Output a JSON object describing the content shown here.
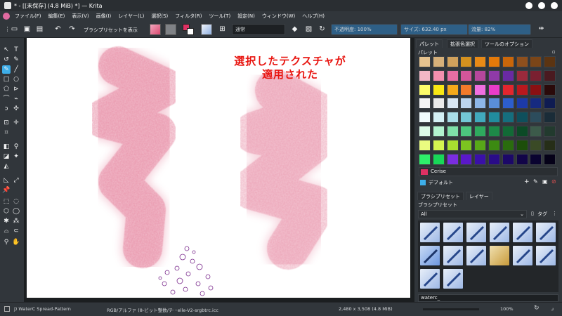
{
  "window": {
    "title": "* - [[未保存] (4.8 MiB) *] — Krita"
  },
  "menu": [
    "ファイル(F)",
    "編集(E)",
    "表示(V)",
    "画像(I)",
    "レイヤー(L)",
    "選択(S)",
    "フィルタ(R)",
    "ツール(T)",
    "設定(N)",
    "ウィンドウ(W)",
    "ヘルプ(H)"
  ],
  "toolbar": {
    "brush_preset_label": "ブラシプリセットを表示",
    "blend_mode": "通常",
    "opacity": "不透明度: 100%",
    "size": "サイズ: 632.40 px",
    "flow": "流量: 82%"
  },
  "canvas": {
    "annotation_line1": "選択したテクスチャが",
    "annotation_line2": "適用された",
    "annotation_color": "#e8140f",
    "stroke_color": "#e37895"
  },
  "palette_docker": {
    "tabs": [
      "パレット",
      "拡張色選択",
      "ツールのオプション"
    ],
    "title": "パレット",
    "selected_color_name": "Cerise",
    "selected_color": "#de3163",
    "palette_set": "デフォルト",
    "colors": [
      "#e6c38f",
      "#d6b07a",
      "#d0a15c",
      "#d4911f",
      "#e88a16",
      "#e3790a",
      "#c9660a",
      "#8e4f1d",
      "#7a4518",
      "#5b3412",
      "#f2b7c6",
      "#f290ae",
      "#e86ea3",
      "#d4569a",
      "#b5479c",
      "#8f3aa8",
      "#6a2aa2",
      "#9c2a3c",
      "#7a2030",
      "#4a1a20",
      "#fdfc6a",
      "#f9e814",
      "#f5a91a",
      "#f37a2a",
      "#f06fe0",
      "#e93cca",
      "#e2262e",
      "#b8181e",
      "#8a1012",
      "#2a0a0a",
      "#f5f5f5",
      "#eaeaea",
      "#d8e6f3",
      "#bcd4ee",
      "#8db6e8",
      "#5a8ed8",
      "#2d5ecc",
      "#1c3aa8",
      "#162a80",
      "#0f1c52",
      "#f0fbfc",
      "#d4f0f5",
      "#a9dde8",
      "#73c7d6",
      "#41a9bd",
      "#218c9e",
      "#156e7e",
      "#0e4f5c",
      "#2c4c5c",
      "#1a2c38",
      "#dcfbe8",
      "#b2f3cf",
      "#7fe0a8",
      "#4cc77e",
      "#2eaa5e",
      "#1d8a48",
      "#126a36",
      "#0c4a26",
      "#3c5a4a",
      "#223a2e",
      "#eafc80",
      "#d4f550",
      "#a8e030",
      "#7cc420",
      "#58a818",
      "#3c8a12",
      "#2a6c0e",
      "#1c4e0a",
      "#3a4a26",
      "#262e18",
      "#2ef06a",
      "#18d858",
      "#7a2de0",
      "#5a18c8",
      "#3a10a8",
      "#2a0c88",
      "#1c0868",
      "#120548",
      "#0a0330",
      "#050118"
    ]
  },
  "layers_docker": {
    "tabs": [
      "ブラシプリセット",
      "レイヤー"
    ]
  },
  "preset_docker": {
    "title": "ブラシプリセット",
    "filter_value": "All",
    "tag_label": "タグ",
    "search_value": "waterc_"
  },
  "status": {
    "brush_name": "j) WaterC Spread-Pattern",
    "color_profile": "RGB/アルファ (8-ビット整数/チ···elle-V2-srgbtrc.icc",
    "image_size": "2,480 x 3,508 (4.8 MiB)",
    "zoom": "100%"
  }
}
